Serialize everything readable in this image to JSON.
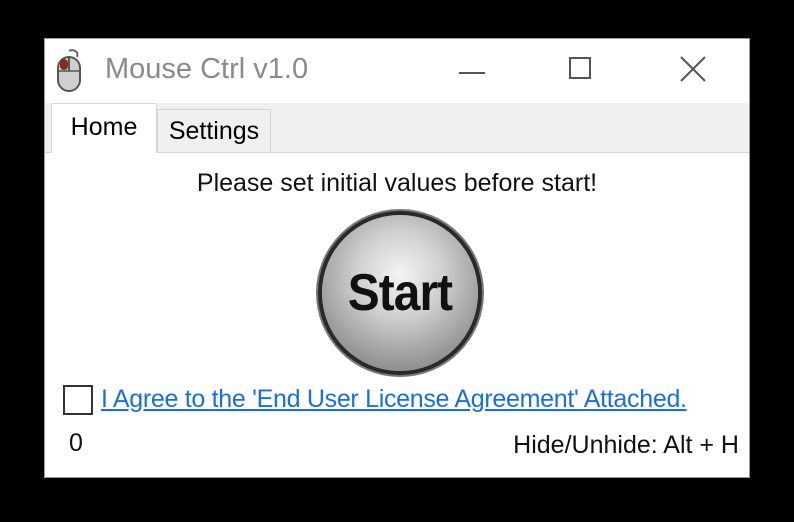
{
  "window": {
    "title": "Mouse Ctrl v1.0"
  },
  "icons": {
    "app": "mouse-icon",
    "minimize": "minimize-icon",
    "maximize": "maximize-icon",
    "close": "close-icon"
  },
  "tabs": [
    {
      "label": "Home",
      "selected": true
    },
    {
      "label": "Settings",
      "selected": false
    }
  ],
  "home": {
    "message": "Please set initial values before start!",
    "start_label": "Start",
    "eula_checked": false,
    "eula_link": "I Agree to the 'End User License Agreement' Attached.",
    "counter": "0",
    "hotkey_hint": "Hide/Unhide: Alt + H"
  },
  "colors": {
    "link": "#1a6fe0",
    "title_text": "#8a8a8a",
    "tab_strip": "#f0f0f0"
  }
}
